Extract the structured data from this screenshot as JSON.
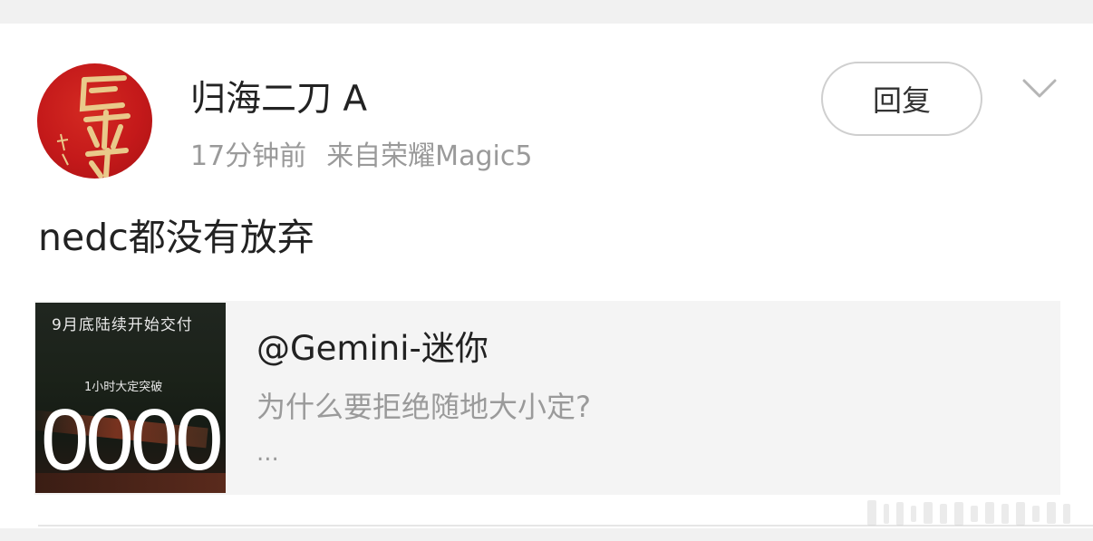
{
  "post": {
    "username": "归海二刀 A",
    "time": "17分钟前",
    "source": "来自荣耀Magic5",
    "reply_label": "回复",
    "text": "nedc都没有放弃"
  },
  "avatar": {
    "icon": "avatar-calligraphy-icon"
  },
  "quoted": {
    "author": "@Gemini-迷你",
    "snippet": "为什么要拒绝随地大小定?",
    "ellipsis": "...",
    "thumbnail": {
      "top_text": "9月底陆续开始交付",
      "mid_text": "1小时大定突破",
      "big_text": "0000"
    }
  },
  "colors": {
    "avatar_red": "#c4191a",
    "text_primary": "#222222",
    "text_secondary": "#9a9a9a",
    "card_bg": "#f4f4f4"
  }
}
